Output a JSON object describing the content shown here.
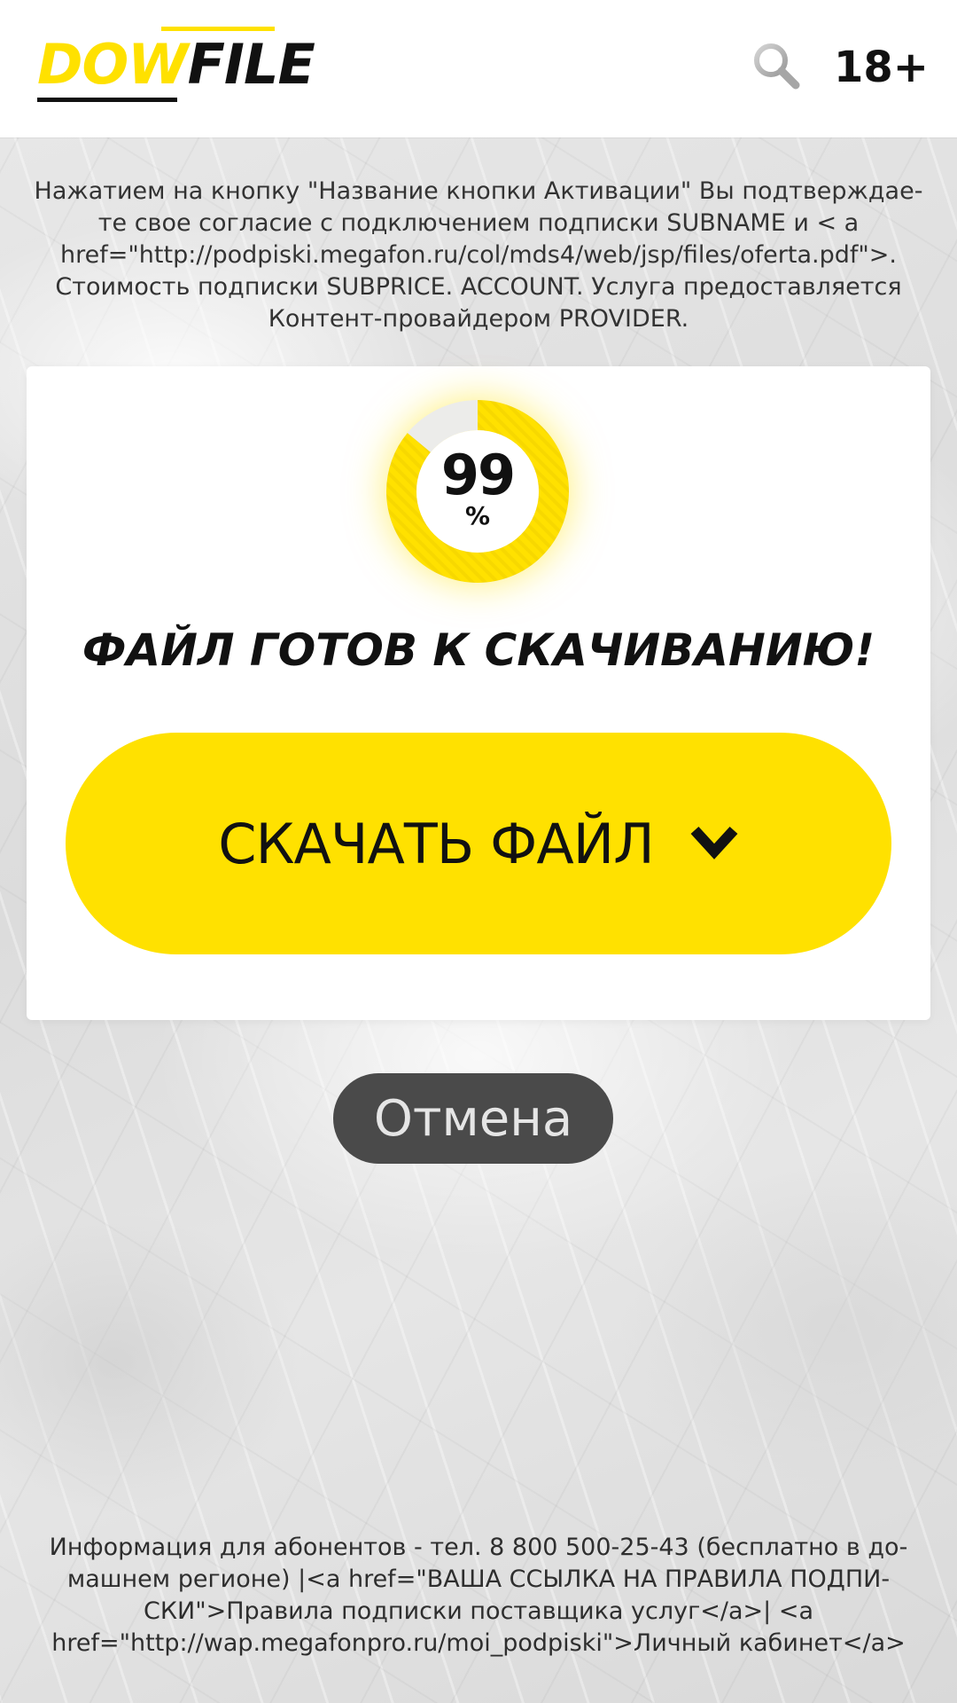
{
  "header": {
    "logo_part1": "DOW",
    "logo_part2": "FILE",
    "search_icon": "search-icon",
    "age_rating": "18+"
  },
  "disclaimer": "Нажатием на кнопку \"Название кнопки Активации\" Вы подтверждае-те свое согласие с подключением подписки SUBNAME и < a href=\"http://podpiski.megafon.ru/col/mds4/web/jsp/files/oferta.pdf\">. Стоимость подписки SUBPRICE. ACCOUNT. Услуга предоставляется Контент-провайдером PROVIDER.",
  "card": {
    "progress_value": "99",
    "progress_unit": "%",
    "progress_fraction": 0.86,
    "title": "ФАЙЛ ГОТОВ К СКАЧИВАНИЮ!",
    "download_label": "СКАЧАТЬ ФАЙЛ",
    "download_icon": "chevron-down-icon"
  },
  "cancel_label": "Отмена",
  "footer_info": "Информация для абонентов - тел. 8 800 500-25-43 (бесплатно в до-машнем регионе) |<a href=\"ВАША ССЫЛКА НА ПРАВИЛА ПОДПИ-СКИ\">Правила подписки поставщика услуг</a>| <a href=\"http://wap.megafonpro.ru/moi_podpiski\">Личный кабинет</a>",
  "colors": {
    "accent": "#ffe100",
    "text_dark": "#111111",
    "cancel_bg": "#4a4a4a"
  }
}
